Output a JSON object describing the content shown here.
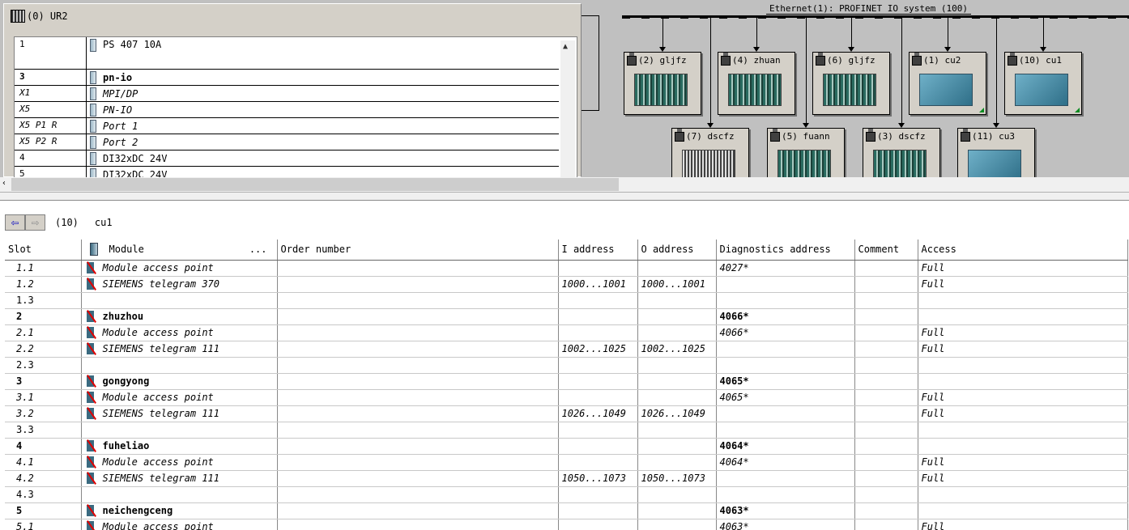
{
  "rack": {
    "title": "(0) UR2",
    "rows": [
      {
        "slot": "1",
        "module": "PS 407 10A",
        "style": "normal"
      },
      {
        "slot": "3",
        "module": "pn-io",
        "style": "bold"
      },
      {
        "slot": "X1",
        "module": "MPI/DP",
        "style": "italic"
      },
      {
        "slot": "X5",
        "module": "PN-IO",
        "style": "italic"
      },
      {
        "slot": "X5 P1 R",
        "module": "Port 1",
        "style": "italic"
      },
      {
        "slot": "X5 P2 R",
        "module": "Port 2",
        "style": "italic"
      },
      {
        "slot": "4",
        "module": "DI32xDC 24V",
        "style": "normal"
      },
      {
        "slot": "5",
        "module": "DI32xDC 24V",
        "style": "normal"
      }
    ]
  },
  "network": {
    "label": "Ethernet(1): PROFINET IO system (100)",
    "devices_row1": [
      {
        "label": "(2) gljfz",
        "kind": "s7"
      },
      {
        "label": "(4) zhuan",
        "kind": "s7"
      },
      {
        "label": "(6) gljfz",
        "kind": "s7"
      },
      {
        "label": "(1) cu2",
        "kind": "drive"
      },
      {
        "label": "(10) cu1",
        "kind": "drive"
      }
    ],
    "devices_row2": [
      {
        "label": "(7) dscfz",
        "kind": "et"
      },
      {
        "label": "(5) fuann",
        "kind": "s7"
      },
      {
        "label": "(3) dscfz",
        "kind": "s7"
      },
      {
        "label": "(11) cu3",
        "kind": "drive"
      }
    ]
  },
  "detail": {
    "back": "⇦",
    "forward": "⇨",
    "station_number": "(10)",
    "station_name": "cu1"
  },
  "table": {
    "headers": {
      "slot": "Slot",
      "module": "Module",
      "module_more": "...",
      "order": "Order number",
      "iaddr": "I address",
      "oaddr": "O address",
      "diag": "Diagnostics address",
      "comment": "Comment",
      "access": "Access"
    },
    "rows": [
      {
        "slot": "1.1",
        "module": "Module access point",
        "order": "",
        "iaddr": "",
        "oaddr": "",
        "diag": "4027*",
        "comment": "",
        "access": "Full",
        "type": "sub"
      },
      {
        "slot": "1.2",
        "module": "SIEMENS telegram 370",
        "order": "",
        "iaddr": "1000...1001",
        "oaddr": "1000...1001",
        "diag": "",
        "comment": "",
        "access": "Full",
        "type": "sub"
      },
      {
        "slot": "1.3",
        "module": "",
        "order": "",
        "iaddr": "",
        "oaddr": "",
        "diag": "",
        "comment": "",
        "access": "",
        "type": "empty"
      },
      {
        "slot": "2",
        "module": "zhuzhou",
        "order": "",
        "iaddr": "",
        "oaddr": "",
        "diag": "4066*",
        "comment": "",
        "access": "",
        "type": "group"
      },
      {
        "slot": "2.1",
        "module": "Module access point",
        "order": "",
        "iaddr": "",
        "oaddr": "",
        "diag": "4066*",
        "comment": "",
        "access": "Full",
        "type": "sub"
      },
      {
        "slot": "2.2",
        "module": "SIEMENS telegram 111",
        "order": "",
        "iaddr": "1002...1025",
        "oaddr": "1002...1025",
        "diag": "",
        "comment": "",
        "access": "Full",
        "type": "sub"
      },
      {
        "slot": "2.3",
        "module": "",
        "order": "",
        "iaddr": "",
        "oaddr": "",
        "diag": "",
        "comment": "",
        "access": "",
        "type": "empty"
      },
      {
        "slot": "3",
        "module": "gongyong",
        "order": "",
        "iaddr": "",
        "oaddr": "",
        "diag": "4065*",
        "comment": "",
        "access": "",
        "type": "group"
      },
      {
        "slot": "3.1",
        "module": "Module access point",
        "order": "",
        "iaddr": "",
        "oaddr": "",
        "diag": "4065*",
        "comment": "",
        "access": "Full",
        "type": "sub"
      },
      {
        "slot": "3.2",
        "module": "SIEMENS telegram 111",
        "order": "",
        "iaddr": "1026...1049",
        "oaddr": "1026...1049",
        "diag": "",
        "comment": "",
        "access": "Full",
        "type": "sub"
      },
      {
        "slot": "3.3",
        "module": "",
        "order": "",
        "iaddr": "",
        "oaddr": "",
        "diag": "",
        "comment": "",
        "access": "",
        "type": "empty"
      },
      {
        "slot": "4",
        "module": "fuheliao",
        "order": "",
        "iaddr": "",
        "oaddr": "",
        "diag": "4064*",
        "comment": "",
        "access": "",
        "type": "group"
      },
      {
        "slot": "4.1",
        "module": "Module access point",
        "order": "",
        "iaddr": "",
        "oaddr": "",
        "diag": "4064*",
        "comment": "",
        "access": "Full",
        "type": "sub"
      },
      {
        "slot": "4.2",
        "module": "SIEMENS telegram 111",
        "order": "",
        "iaddr": "1050...1073",
        "oaddr": "1050...1073",
        "diag": "",
        "comment": "",
        "access": "Full",
        "type": "sub"
      },
      {
        "slot": "4.3",
        "module": "",
        "order": "",
        "iaddr": "",
        "oaddr": "",
        "diag": "",
        "comment": "",
        "access": "",
        "type": "empty"
      },
      {
        "slot": "5",
        "module": "neichengceng",
        "order": "",
        "iaddr": "",
        "oaddr": "",
        "diag": "4063*",
        "comment": "",
        "access": "",
        "type": "group"
      },
      {
        "slot": "5.1",
        "module": "Module access point",
        "order": "",
        "iaddr": "",
        "oaddr": "",
        "diag": "4063*",
        "comment": "",
        "access": "Full",
        "type": "sub"
      }
    ]
  },
  "colors": {
    "background_top": "#c0c0c0",
    "window_face": "#d4d0c8",
    "grid_lines": "#888888",
    "module_fault": "#e00000"
  }
}
